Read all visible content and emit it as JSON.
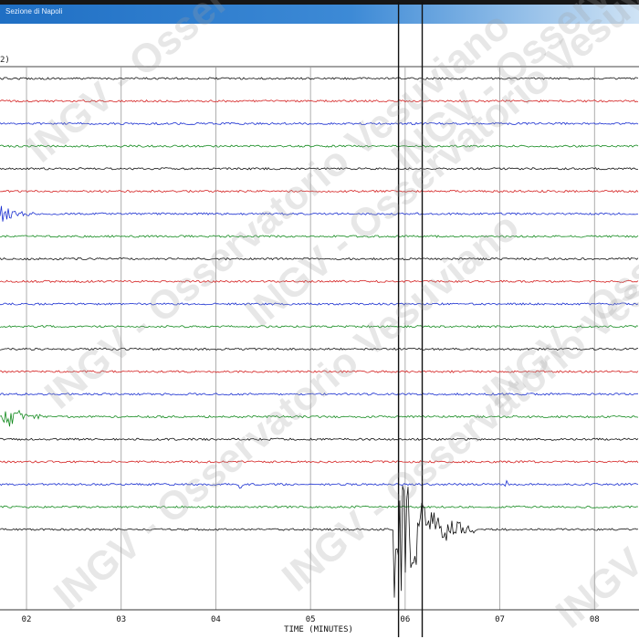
{
  "window": {
    "title": "Sezione di Napoli"
  },
  "trace_label": "2)",
  "colors": {
    "black": "#111111",
    "red": "#d42020",
    "blue": "#1a2fd0",
    "green": "#138a1e"
  },
  "watermark": {
    "text": "INGV - Osservatorio Vesuviano"
  },
  "chart_data": {
    "type": "line",
    "title": "",
    "xlabel": "TIME (MINUTES)",
    "ylabel": "",
    "x_ticks": [
      "02",
      "03",
      "04",
      "05",
      "06",
      "07",
      "08"
    ],
    "x_tick_values": [
      2,
      3,
      4,
      5,
      6,
      7,
      8
    ],
    "xlim": [
      1.72,
      8.47
    ],
    "grid": true,
    "trace_color_cycle": [
      "black",
      "red",
      "blue",
      "green"
    ],
    "trace_count": 21,
    "events": [
      {
        "trace": 6,
        "start_min": 1.72,
        "end_min": 2.12,
        "amplitude": "small",
        "color": "blue"
      },
      {
        "trace": 15,
        "start_min": 1.74,
        "end_min": 2.15,
        "amplitude": "medium",
        "color": "green"
      },
      {
        "trace": 20,
        "start_min": 5.88,
        "end_min": 6.75,
        "amplitude": "very large",
        "color": "black"
      },
      {
        "trace": 18,
        "start_min": 4.25,
        "end_min": 4.29,
        "amplitude": "small",
        "color": "blue"
      },
      {
        "trace": 18,
        "start_min": 7.05,
        "end_min": 7.12,
        "amplitude": "small",
        "color": "blue"
      }
    ]
  }
}
